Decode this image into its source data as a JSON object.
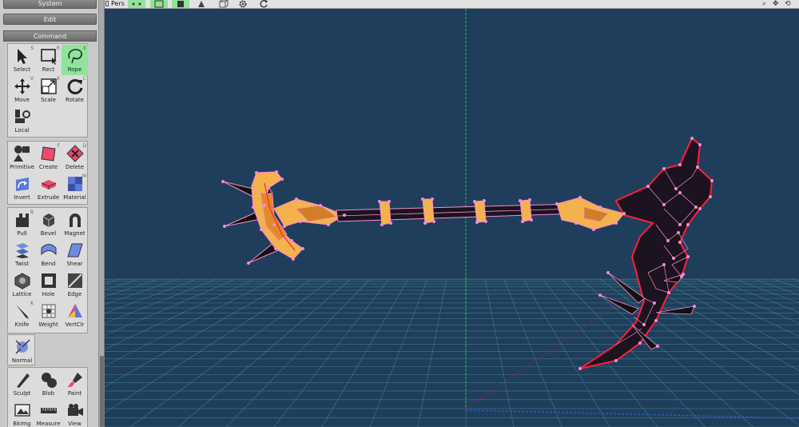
{
  "panel": {
    "system_label": "System",
    "edit_label": "Edit",
    "command_label": "Command"
  },
  "tools": {
    "select": {
      "label": "Select",
      "key": "S"
    },
    "rect": {
      "label": "Rect",
      "key": "R"
    },
    "rope": {
      "label": "Rope",
      "key": "E"
    },
    "move": {
      "label": "Move",
      "key": "V"
    },
    "scale": {
      "label": "Scale",
      "key": "X"
    },
    "rotate": {
      "label": "Rotate",
      "key": "C"
    },
    "local": {
      "label": "Local"
    },
    "primitive": {
      "label": "Primitive"
    },
    "create": {
      "label": "Create",
      "key": "F"
    },
    "delete": {
      "label": "Delete",
      "key": "D"
    },
    "invert": {
      "label": "Invert"
    },
    "extrude": {
      "label": "Extrude"
    },
    "material": {
      "label": "Material",
      "key": "M"
    },
    "pull": {
      "label": "Pull",
      "key": "B"
    },
    "bevel": {
      "label": "Bevel"
    },
    "magnet": {
      "label": "Magnet"
    },
    "twist": {
      "label": "Twist"
    },
    "bend": {
      "label": "Bend"
    },
    "shear": {
      "label": "Shear"
    },
    "lattice": {
      "label": "Lattice"
    },
    "hole": {
      "label": "Hole"
    },
    "edge": {
      "label": "Edge"
    },
    "knife": {
      "label": "Knife",
      "key": "K"
    },
    "weight": {
      "label": "Weight"
    },
    "vertclr": {
      "label": "VertClr"
    },
    "normal": {
      "label": "Normal"
    },
    "sculpt": {
      "label": "Sculpt"
    },
    "blob": {
      "label": "Blob"
    },
    "paint": {
      "label": "Paint"
    },
    "bkimg": {
      "label": "BkImg"
    },
    "measure": {
      "label": "Measure"
    },
    "view": {
      "label": "View"
    }
  },
  "toolbar": {
    "view_mode": "Pers"
  },
  "colors": {
    "viewport_bg": "#1f3e5c",
    "grid": "#4f8e97",
    "axis_y": "#26c24a",
    "axis_z": "#8a2a36",
    "axis_x": "#2f5fc9",
    "mesh_orange": "#f3b24c",
    "mesh_edge": "#ff8ad0",
    "selected_edge": "#ff1f3a",
    "active_tool": "#8fe39b"
  }
}
